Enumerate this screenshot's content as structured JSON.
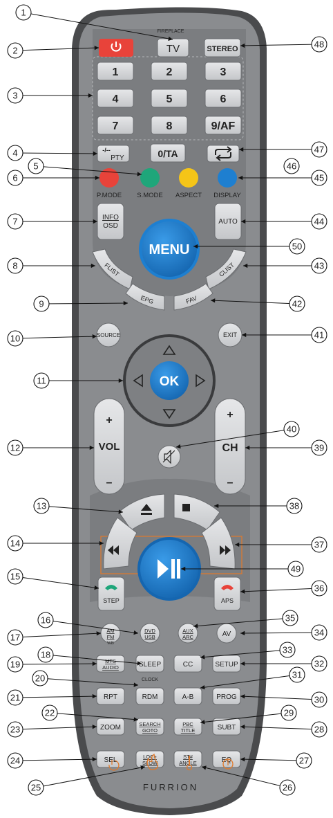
{
  "colors": {
    "body_outer": "#4a4b4d",
    "body_face": "#8a8c8f",
    "panel_light": "#a4a6a9",
    "button": "#d4d6d8",
    "power": "#e8433a",
    "ok_blue": "#1e7fd0",
    "red_key": "#e8433a",
    "green_key": "#1fa67a",
    "yellow_key": "#f5c518",
    "blue_key": "#1e7fd0",
    "fireplace_orange": "#e07a2c",
    "call_green": "#1fa67a",
    "call_red": "#e8433a"
  },
  "top": {
    "fireplace_label": "FIREPLACE",
    "tv": "TV",
    "stereo": "STEREO"
  },
  "numpad": {
    "keys": [
      "1",
      "2",
      "3",
      "4",
      "5",
      "6",
      "7",
      "8",
      "9/AF"
    ],
    "pty_top": "-/--",
    "pty_bottom": "PTY",
    "zero": "0/TA"
  },
  "color_keys": [
    "P.MODE",
    "S.MODE",
    "ASPECT",
    "DISPLAY"
  ],
  "info_top": "INFO",
  "info_bottom": "OSD",
  "auto": "AUTO",
  "menu": "MENU",
  "flist": "FLIST",
  "clist": "CLIST",
  "epg": "EPG",
  "fav": "FAV",
  "source": "SOURCE",
  "exit": "EXIT",
  "ok": "OK",
  "vol": "VOL",
  "ch": "CH",
  "plus": "+",
  "minus": "–",
  "step": "STEP",
  "aps": "APS",
  "media_rows": [
    [
      "AM FM",
      "DVD USB",
      "AUX ARC",
      "AV"
    ],
    [
      "MTS AUDIO",
      "SLEEP",
      "CC",
      "SETUP"
    ],
    [
      "RPT",
      "RDM",
      "A-B",
      "PROG"
    ],
    [
      "ZOOM",
      "SEARCH GOTO",
      "PBC TITLE",
      "SUBT"
    ],
    [
      "SEL",
      "LOC+ SLOW",
      "ST# ANGLE",
      "EQ"
    ]
  ],
  "small_labels": {
    "wb": "WB",
    "clock": "CLOCK"
  },
  "brand": "FURRION",
  "callouts": {
    "c1": "1",
    "c2": "2",
    "c3": "3",
    "c4": "4",
    "c5": "5",
    "c6": "6",
    "c7": "7",
    "c8": "8",
    "c9": "9",
    "c10": "10",
    "c11": "11",
    "c12": "12",
    "c13": "13",
    "c14": "14",
    "c15": "15",
    "c16": "16",
    "c17": "17",
    "c18": "18",
    "c19": "19",
    "c20": "20",
    "c21": "21",
    "c22": "22",
    "c23": "23",
    "c24": "24",
    "c25": "25",
    "c26": "26",
    "c27": "27",
    "c28": "28",
    "c29": "29",
    "c30": "30",
    "c31": "31",
    "c32": "32",
    "c33": "33",
    "c34": "34",
    "c35": "35",
    "c36": "36",
    "c37": "37",
    "c38": "38",
    "c39": "39",
    "c40": "40",
    "c41": "41",
    "c42": "42",
    "c43": "43",
    "c44": "44",
    "c45": "45",
    "c46": "46",
    "c47": "47",
    "c48": "48",
    "c49": "49",
    "c50": "50"
  }
}
